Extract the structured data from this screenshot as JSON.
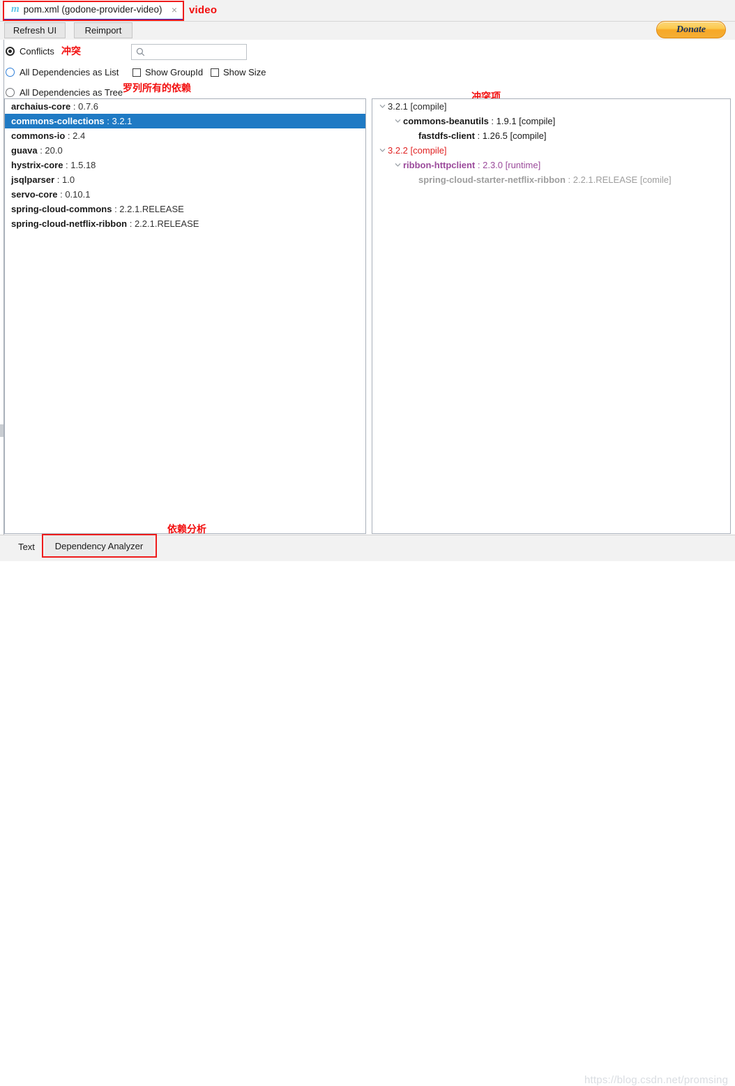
{
  "editor_tab": {
    "icon": "maven-m-icon",
    "label": "pom.xml (godone-provider-video)",
    "close": "×"
  },
  "annotations": {
    "video": "video",
    "conflicts_cn": "冲突",
    "all_deps_cn": "罗列所有的依赖",
    "conflict_items_cn": "冲突项",
    "dependency_analysis_cn": "依赖分析",
    "color": "#f20e0e"
  },
  "toolbar": {
    "refresh_label": "Refresh UI",
    "reimport_label": "Reimport",
    "donate_label": "Donate"
  },
  "options": {
    "radios": [
      {
        "label": "Conflicts",
        "checked": true,
        "ring": "dark"
      },
      {
        "label": "All Dependencies as List",
        "checked": false,
        "ring": "blue"
      },
      {
        "label": "All Dependencies as Tree",
        "checked": false,
        "ring": "gray"
      }
    ],
    "checkboxes": [
      {
        "label": "Show GroupId",
        "checked": false
      },
      {
        "label": "Show Size",
        "checked": false
      }
    ],
    "search": {
      "icon": "search-icon",
      "value": "",
      "placeholder": ""
    }
  },
  "dependency_list": [
    {
      "artifact": "archaius-core",
      "version": "0.7.6",
      "selected": false
    },
    {
      "artifact": "commons-collections",
      "version": "3.2.1",
      "selected": true
    },
    {
      "artifact": "commons-io",
      "version": "2.4",
      "selected": false
    },
    {
      "artifact": "guava",
      "version": "20.0",
      "selected": false
    },
    {
      "artifact": "hystrix-core",
      "version": "1.5.18",
      "selected": false
    },
    {
      "artifact": "jsqlparser",
      "version": "1.0",
      "selected": false
    },
    {
      "artifact": "servo-core",
      "version": "0.10.1",
      "selected": false
    },
    {
      "artifact": "spring-cloud-commons",
      "version": "2.2.1.RELEASE",
      "selected": false
    },
    {
      "artifact": "spring-cloud-netflix-ribbon",
      "version": "2.2.1.RELEASE",
      "selected": false
    }
  ],
  "conflict_tree": [
    {
      "indent": 0,
      "expanded": true,
      "artifact": "",
      "version": "3.2.1",
      "scope": "[compile]",
      "color": "#2b2b2b",
      "bold_artifact": false
    },
    {
      "indent": 1,
      "expanded": true,
      "artifact": "commons-beanutils",
      "version": "1.9.1",
      "scope": "[compile]",
      "color": "#1a1a1a",
      "bold_artifact": true
    },
    {
      "indent": 2,
      "expanded": false,
      "artifact": "fastdfs-client",
      "version": "1.26.5",
      "scope": "[compile]",
      "color": "#1a1a1a",
      "bold_artifact": true
    },
    {
      "indent": 0,
      "expanded": true,
      "artifact": "",
      "version": "3.2.2",
      "scope": "[compile]",
      "color": "#e02222",
      "bold_artifact": false
    },
    {
      "indent": 1,
      "expanded": true,
      "artifact": "ribbon-httpclient",
      "version": "2.3.0",
      "scope": "[runtime]",
      "color": "#9b4a9b",
      "bold_artifact": true
    },
    {
      "indent": 2,
      "expanded": false,
      "artifact": "spring-cloud-starter-netflix-ribbon",
      "version": "2.2.1.RELEASE",
      "scope": "[comile]",
      "color": "#9e9e9e",
      "bold_artifact": true
    }
  ],
  "bottom_tabs": [
    {
      "label": "Text",
      "active": false
    },
    {
      "label": "Dependency Analyzer",
      "active": true
    }
  ],
  "watermark": "https://blog.csdn.net/promsing"
}
